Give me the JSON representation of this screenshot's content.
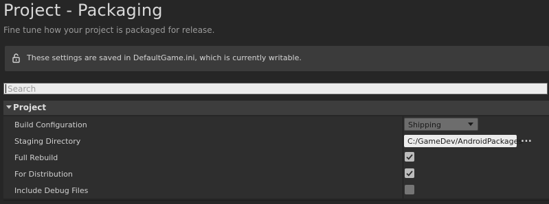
{
  "header": {
    "title": "Project - Packaging",
    "subtitle": "Fine tune how your project is packaged for release."
  },
  "notice": {
    "icon": "unlock-icon",
    "message": "These settings are saved in DefaultGame.ini, which is currently writable."
  },
  "search": {
    "placeholder": "Search",
    "value": ""
  },
  "category": {
    "label": "Project",
    "expanded": true
  },
  "settings": {
    "build_configuration": {
      "label": "Build Configuration",
      "value": "Shipping"
    },
    "staging_directory": {
      "label": "Staging Directory",
      "value": "C:/GameDev/AndroidPackages",
      "browse_label": "..."
    },
    "full_rebuild": {
      "label": "Full Rebuild",
      "checked": true
    },
    "for_distribution": {
      "label": "For Distribution",
      "checked": true
    },
    "include_debug_files": {
      "label": "Include Debug Files",
      "checked": false
    }
  },
  "colors": {
    "background": "#262626",
    "panel": "#2e2e2e",
    "category_header": "#3d3d3d",
    "notice_bar": "#3b3b3b",
    "text": "#cfcfcf"
  }
}
